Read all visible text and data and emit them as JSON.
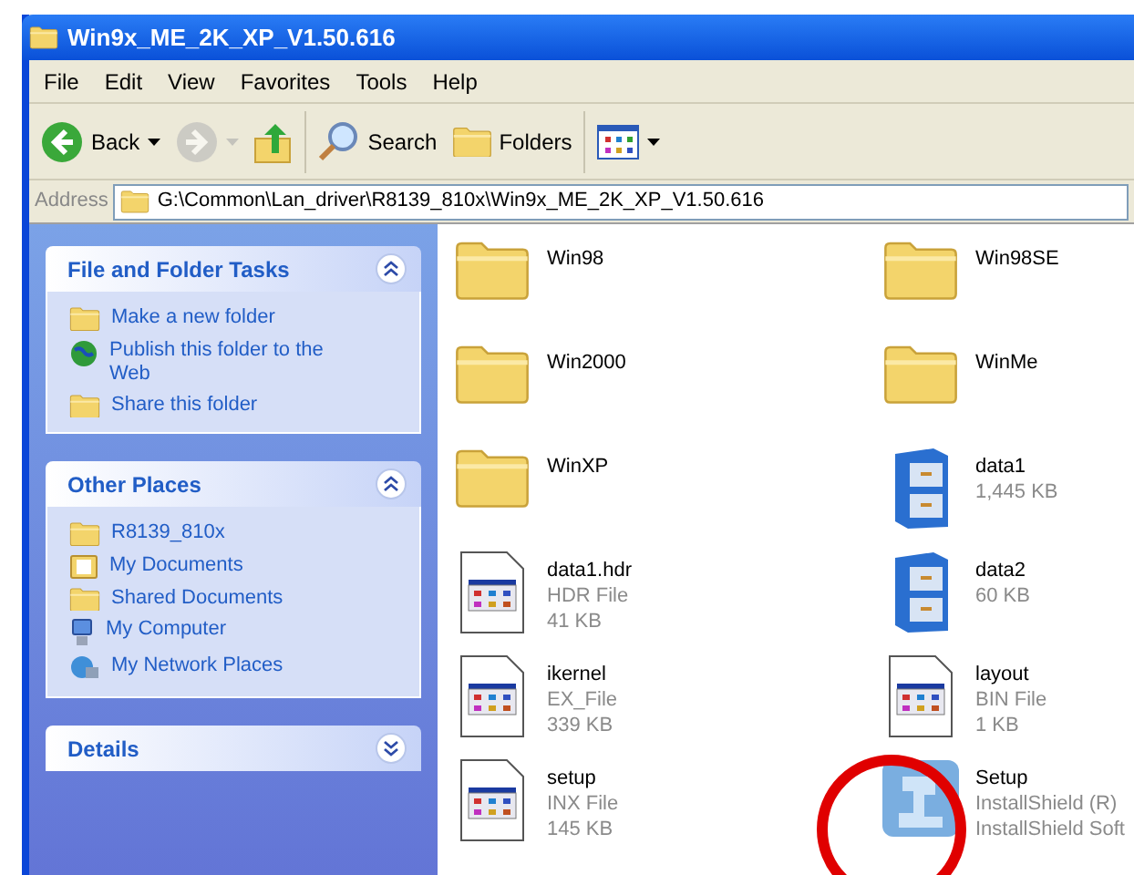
{
  "window": {
    "title": "Win9x_ME_2K_XP_V1.50.616"
  },
  "menu": [
    "File",
    "Edit",
    "View",
    "Favorites",
    "Tools",
    "Help"
  ],
  "toolbar": [
    {
      "kind": "back",
      "label": "Back",
      "disabled": false
    },
    {
      "kind": "forward",
      "disabled": true
    },
    {
      "kind": "up",
      "disabled": false
    },
    {
      "kind": "search",
      "label": "Search",
      "disabled": false
    },
    {
      "kind": "folders",
      "label": "Folders",
      "disabled": false
    },
    {
      "kind": "views",
      "disabled": false
    }
  ],
  "address": {
    "label": "Address",
    "value": "G:\\Common\\Lan_driver\\R8139_810x\\Win9x_ME_2K_XP_V1.50.616"
  },
  "panels": [
    {
      "title": "File and Folder Tasks",
      "expanded": true,
      "items": [
        {
          "kind": "newfolder",
          "label": "Make a new folder"
        },
        {
          "kind": "globe",
          "label": "Publish this folder to the Web"
        },
        {
          "kind": "share",
          "label": "Share this folder"
        }
      ]
    },
    {
      "title": "Other Places",
      "expanded": true,
      "items": [
        {
          "kind": "folder",
          "label": "R8139_810x"
        },
        {
          "kind": "documents",
          "label": "My Documents"
        },
        {
          "kind": "folder",
          "label": "Shared Documents"
        },
        {
          "kind": "computer",
          "label": "My Computer"
        },
        {
          "kind": "network",
          "label": "My Network Places"
        }
      ]
    },
    {
      "title": "Details",
      "expanded": false
    }
  ],
  "files": [
    {
      "kind": "folder",
      "name": "Win98"
    },
    {
      "kind": "folder",
      "name": "Win98SE"
    },
    {
      "kind": "folder",
      "name": "Win2000"
    },
    {
      "kind": "folder",
      "name": "WinMe"
    },
    {
      "kind": "folder",
      "name": "WinXP"
    },
    {
      "kind": "cabinet",
      "name": "data1",
      "details": [
        "1,445 KB"
      ]
    },
    {
      "kind": "document",
      "name": "data1.hdr",
      "details": [
        "HDR File",
        "41 KB"
      ]
    },
    {
      "kind": "cabinet",
      "name": "data2",
      "details": [
        "60 KB"
      ]
    },
    {
      "kind": "document",
      "name": "ikernel",
      "details": [
        "EX_File",
        "339 KB"
      ]
    },
    {
      "kind": "document",
      "name": "layout",
      "details": [
        "BIN File",
        "1 KB"
      ]
    },
    {
      "kind": "document",
      "name": "setup",
      "details": [
        "INX File",
        "145 KB"
      ]
    },
    {
      "kind": "installer",
      "name": "Setup",
      "details": [
        "InstallShield (R)",
        "InstallShield Soft"
      ]
    }
  ]
}
